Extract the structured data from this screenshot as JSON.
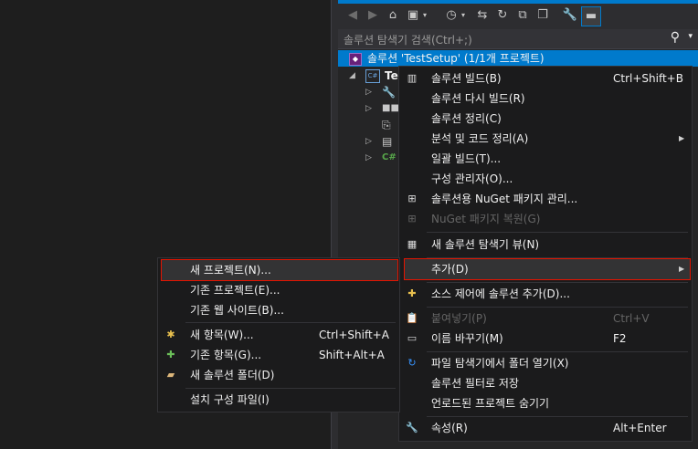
{
  "solution_explorer": {
    "search_placeholder": "솔루션 탐색기 검색(Ctrl+;)",
    "solution_label": "솔루션 'TestSetup' (1/1개 프로젝트)",
    "project_label": "Te",
    "cs_label": "C#"
  },
  "context_menu": {
    "items": [
      {
        "label": "솔루션 빌드(B)",
        "shortcut": "Ctrl+Shift+B"
      },
      {
        "label": "솔루션 다시 빌드(R)",
        "shortcut": ""
      },
      {
        "label": "솔루션 정리(C)",
        "shortcut": ""
      },
      {
        "label": "분석 및 코드 정리(A)",
        "shortcut": ""
      },
      {
        "label": "일괄 빌드(T)...",
        "shortcut": ""
      },
      {
        "label": "구성 관리자(O)...",
        "shortcut": ""
      },
      {
        "label": "솔루션용 NuGet 패키지 관리...",
        "shortcut": ""
      },
      {
        "label": "NuGet 패키지 복원(G)",
        "shortcut": ""
      },
      {
        "label": "새 솔루션 탐색기 뷰(N)",
        "shortcut": ""
      },
      {
        "label": "추가(D)",
        "shortcut": ""
      },
      {
        "label": "소스 제어에 솔루션 추가(D)...",
        "shortcut": ""
      },
      {
        "label": "붙여넣기(P)",
        "shortcut": "Ctrl+V"
      },
      {
        "label": "이름 바꾸기(M)",
        "shortcut": "F2"
      },
      {
        "label": "파일 탐색기에서 폴더 열기(X)",
        "shortcut": ""
      },
      {
        "label": "솔루션 필터로 저장",
        "shortcut": ""
      },
      {
        "label": "언로드된 프로젝트 숨기기",
        "shortcut": ""
      },
      {
        "label": "속성(R)",
        "shortcut": "Alt+Enter"
      }
    ]
  },
  "submenu": {
    "items": [
      {
        "label": "새 프로젝트(N)...",
        "shortcut": ""
      },
      {
        "label": "기존 프로젝트(E)...",
        "shortcut": ""
      },
      {
        "label": "기존 웹 사이트(B)...",
        "shortcut": ""
      },
      {
        "label": "새 항목(W)...",
        "shortcut": "Ctrl+Shift+A"
      },
      {
        "label": "기존 항목(G)...",
        "shortcut": "Shift+Alt+A"
      },
      {
        "label": "새 솔루션 폴더(D)",
        "shortcut": ""
      },
      {
        "label": "설치 구성 파일(I)",
        "shortcut": ""
      }
    ]
  },
  "colors": {
    "accent": "#007acc",
    "highlight_border": "#e51400",
    "menu_bg": "#1b1b1c"
  }
}
